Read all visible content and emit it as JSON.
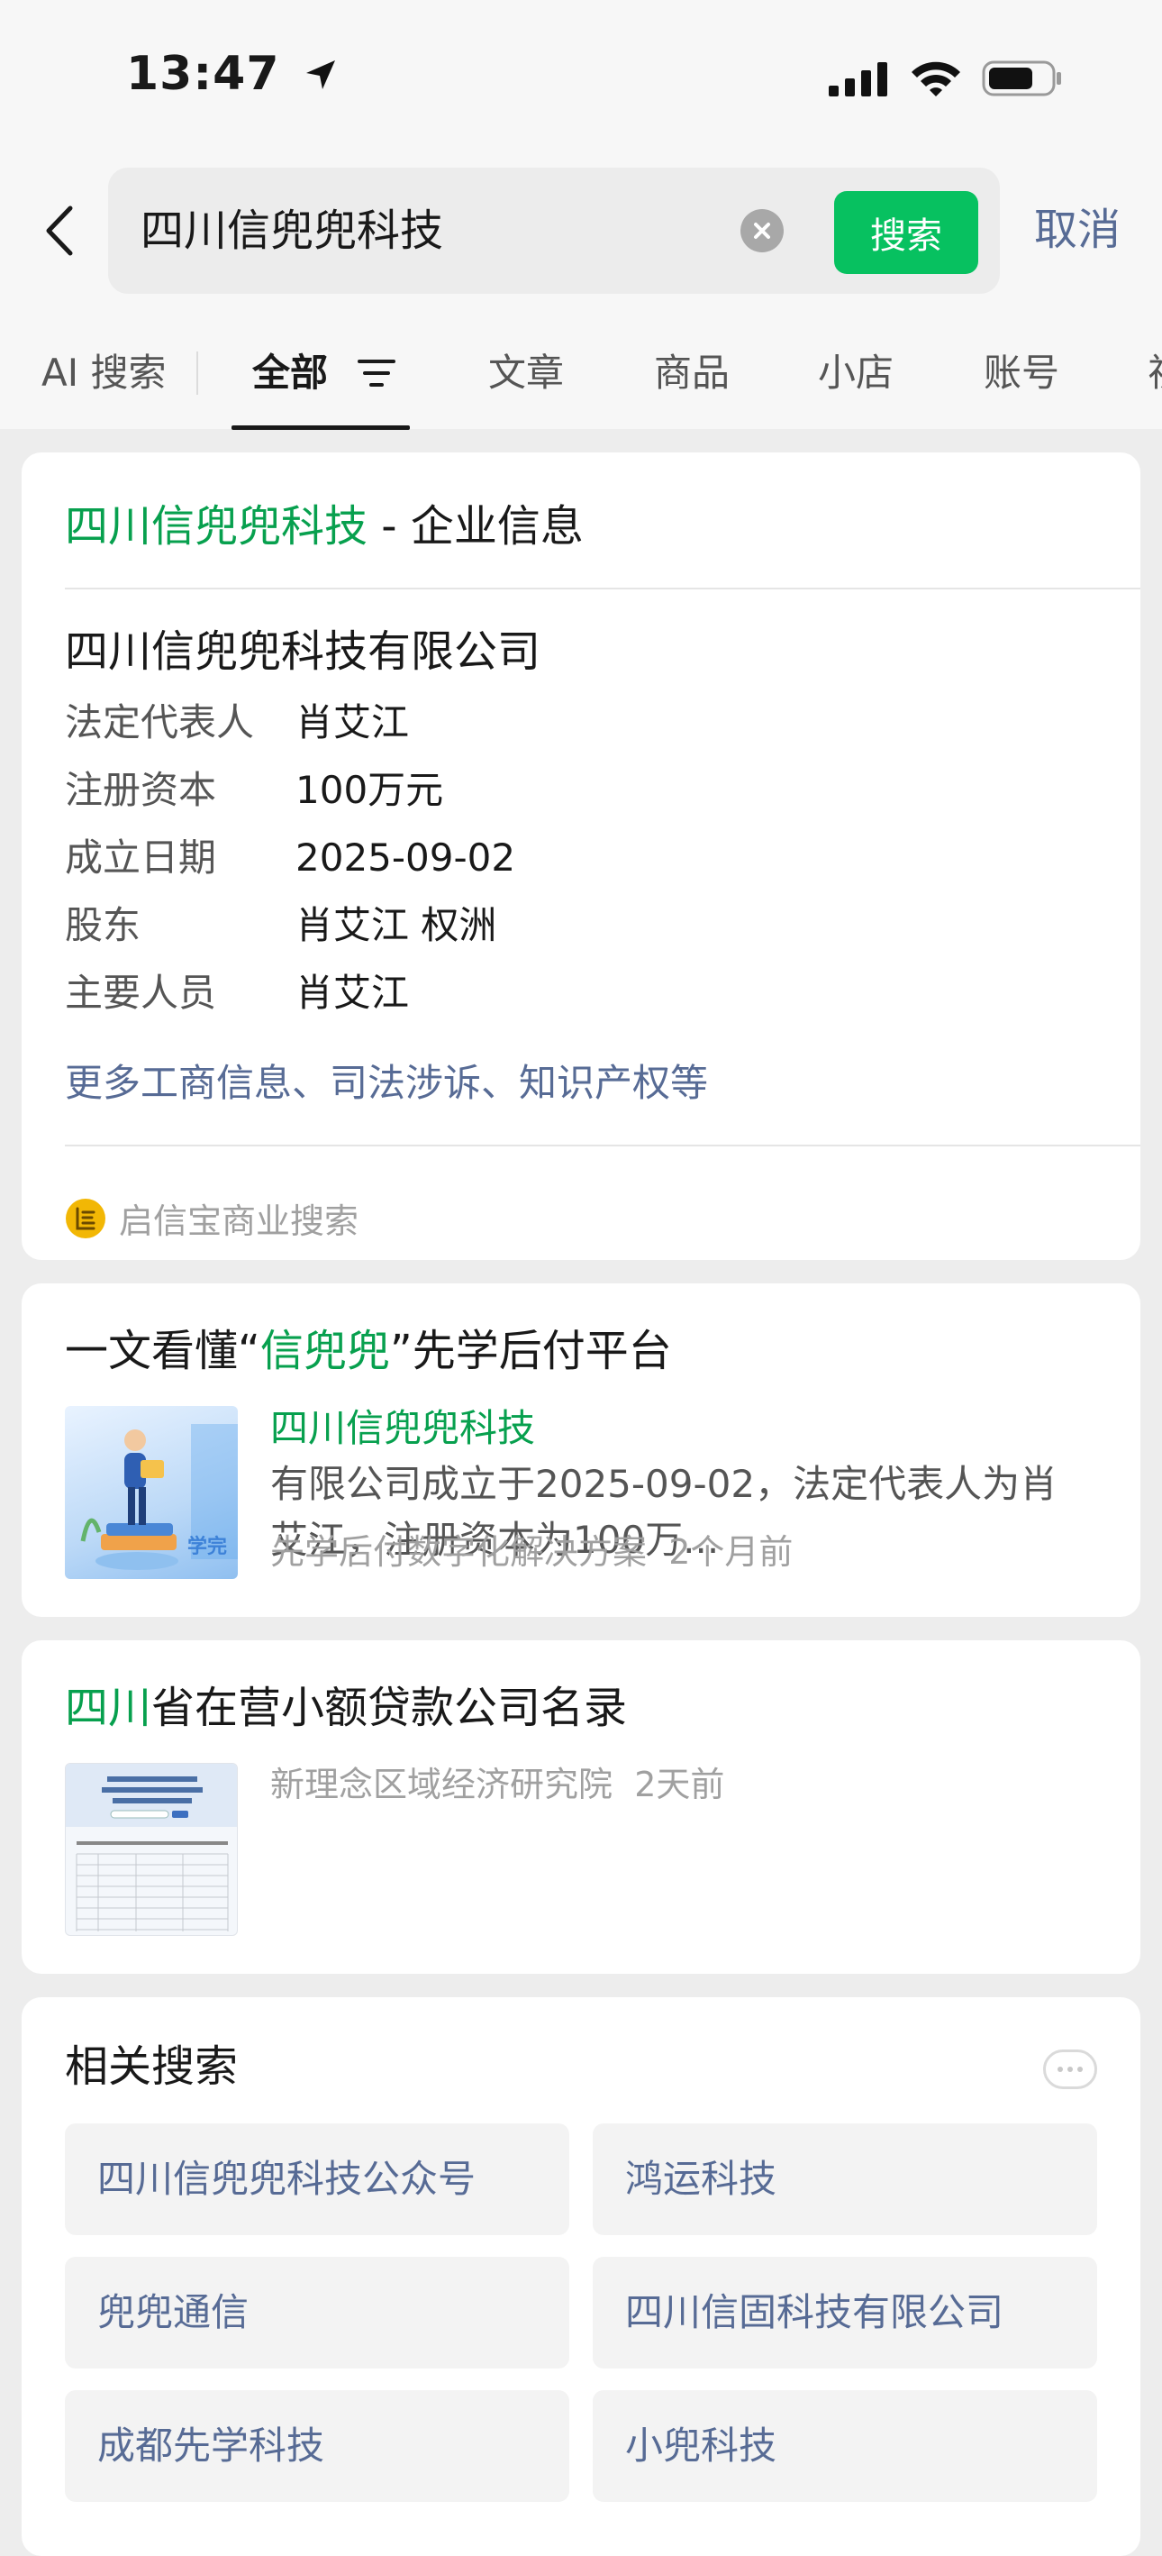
{
  "status_bar": {
    "time": "13:47"
  },
  "search": {
    "query": "四川信兜兜科技",
    "search_label": "搜索",
    "cancel_label": "取消"
  },
  "tabs": [
    {
      "label": "AI 搜索"
    },
    {
      "label": "全部"
    },
    {
      "label": "文章"
    },
    {
      "label": "商品"
    },
    {
      "label": "小店"
    },
    {
      "label": "账号"
    },
    {
      "label": "视"
    }
  ],
  "company_card": {
    "title_highlight": "四川信兜兜科技",
    "title_rest": " - 企业信息",
    "company_name": "四川信兜兜科技有限公司",
    "fields": [
      {
        "key": "法定代表人",
        "value": "肖艾江"
      },
      {
        "key": "注册资本",
        "value": "100万元"
      },
      {
        "key": "成立日期",
        "value": "2025-09-02"
      },
      {
        "key": "股东",
        "value": "肖艾江 权洲"
      },
      {
        "key": "主要人员",
        "value": "肖艾江"
      }
    ],
    "more_link": "更多工商信息、司法涉诉、知识产权等",
    "source": "启信宝商业搜索"
  },
  "results": [
    {
      "title_pre": "一文看懂“",
      "title_highlight": "信兜兜",
      "title_post": "”先学后付平台",
      "snippet_highlight": "四川信兜兜科技",
      "snippet_rest": "有限公司成立于2025-09-02，法定代表人为肖艾江，注册资本为100万...",
      "source": "先学后付数字化解决方案",
      "time": "2个月前",
      "thumb_text": "学完"
    },
    {
      "title_highlight": "四川",
      "title_rest": "省在营小额贷款公司名录",
      "source": "新理念区域经济研究院",
      "time": "2天前"
    }
  ],
  "related": {
    "title": "相关搜索",
    "items": [
      "四川信兜兜科技公众号",
      "鸿运科技",
      "兜兜通信",
      "四川信固科技有限公司",
      "成都先学科技",
      "小兜科技"
    ]
  }
}
